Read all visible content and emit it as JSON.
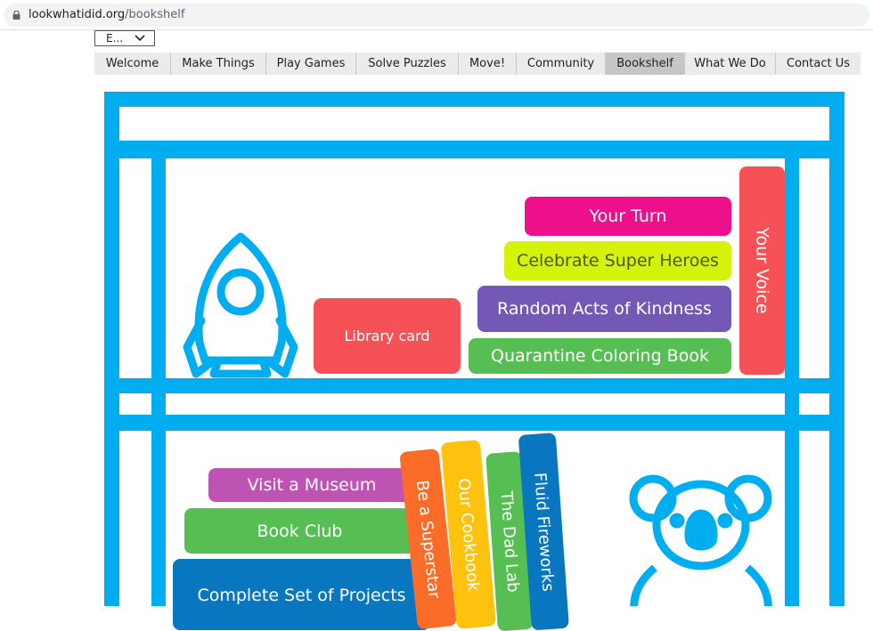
{
  "browser": {
    "domain": "lookwhatidid.org",
    "path": "/bookshelf"
  },
  "language_select": {
    "value": "E..."
  },
  "nav": {
    "items": [
      {
        "label": "Welcome",
        "active": false
      },
      {
        "label": "Make Things",
        "active": false
      },
      {
        "label": "Play Games",
        "active": false
      },
      {
        "label": "Solve Puzzles",
        "active": false
      },
      {
        "label": "Move!",
        "active": false
      },
      {
        "label": "Community",
        "active": false
      },
      {
        "label": "Bookshelf",
        "active": true
      },
      {
        "label": "What We Do",
        "active": false
      },
      {
        "label": "Contact Us",
        "active": false
      }
    ]
  },
  "shelf": {
    "frame_color": "#00aeef",
    "top_shelf": {
      "decor_icon": "rocket-icon",
      "library_card": {
        "label": "Library card",
        "color": "#f75158"
      },
      "books": [
        {
          "label": "Your Turn",
          "color": "#ed0f8c"
        },
        {
          "label": "Celebrate Super Heroes",
          "color": "#d5f20a"
        },
        {
          "label": "Random Acts of Kindness",
          "color": "#7358b6"
        },
        {
          "label": "Quarantine Coloring Book",
          "color": "#56be52"
        }
      ],
      "standing_book": {
        "label": "Your Voice",
        "color": "#f75158"
      }
    },
    "bottom_shelf": {
      "decor_icon": "koala-icon",
      "stack": [
        {
          "label": "Visit a Museum",
          "color": "#bf53b4"
        },
        {
          "label": "Book Club",
          "color": "#56be52"
        },
        {
          "label": "Complete Set of Projects",
          "color": "#0977bf"
        }
      ],
      "spines": [
        {
          "label": "Be a Superstar",
          "color": "#fb6c28"
        },
        {
          "label": "Our Cookbook",
          "color": "#ffc20e"
        },
        {
          "label": "The Dad Lab",
          "color": "#56be52"
        },
        {
          "label": "Fluid Fireworks",
          "color": "#0977bf"
        }
      ]
    }
  }
}
